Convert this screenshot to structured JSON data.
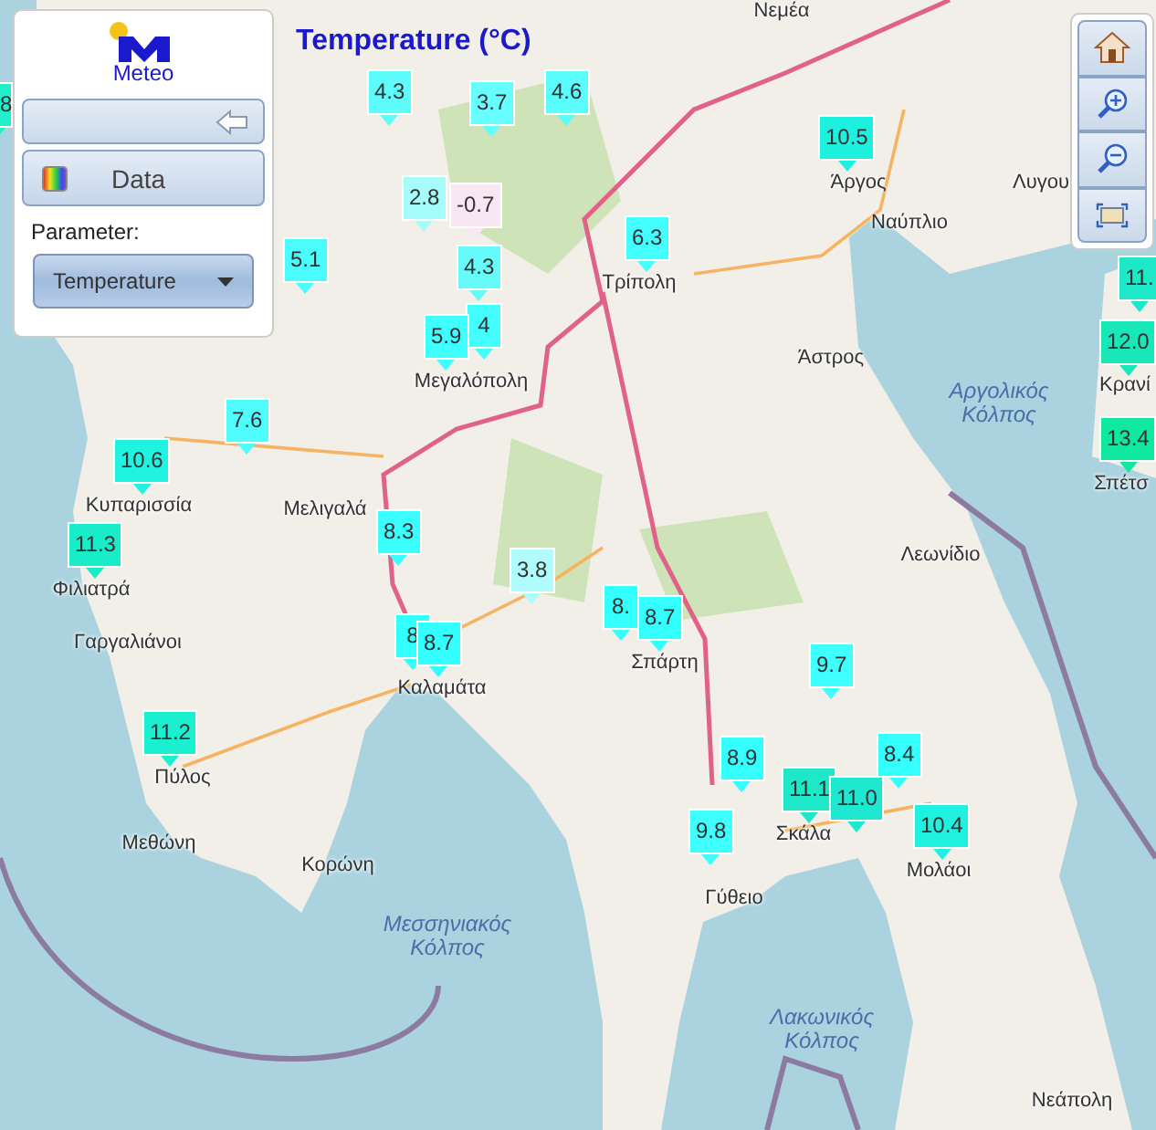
{
  "panel": {
    "logo_text": "Meteo",
    "data_button": "Data",
    "parameter_label": "Parameter:",
    "parameter_value": "Temperature"
  },
  "title": "Temperature (°C)",
  "markers": [
    {
      "value": "8",
      "color": "#22eecc"
    },
    {
      "value": "4.3",
      "color": "#5ffcfc"
    },
    {
      "value": "3.7",
      "color": "#66fefe"
    },
    {
      "value": "4.6",
      "color": "#5afcfc"
    },
    {
      "value": "2.8",
      "color": "#a6fbfb"
    },
    {
      "value": "-0.7",
      "color": "#f8e6f2"
    },
    {
      "value": "4.3",
      "color": "#66fafa"
    },
    {
      "value": "5.1",
      "color": "#4cfcfc"
    },
    {
      "value": "4",
      "color": "#44fefe"
    },
    {
      "value": "5.9",
      "color": "#40ffff"
    },
    {
      "value": "6.3",
      "color": "#44ffff"
    },
    {
      "value": "10.5",
      "color": "#1ef0e0"
    },
    {
      "value": "11.",
      "color": "#1ee8c8"
    },
    {
      "value": "12.0",
      "color": "#18e8b8"
    },
    {
      "value": "13.4",
      "color": "#10e8a0"
    },
    {
      "value": "7.6",
      "color": "#50fcfc"
    },
    {
      "value": "10.6",
      "color": "#20f4e0"
    },
    {
      "value": "11.3",
      "color": "#18ecc8"
    },
    {
      "value": "8.3",
      "color": "#3cfefe"
    },
    {
      "value": "3.8",
      "color": "#b0fbfb"
    },
    {
      "value": "8",
      "color": "#33ffff"
    },
    {
      "value": "8.7",
      "color": "#33ffff"
    },
    {
      "value": "11.2",
      "color": "#1af0d0"
    },
    {
      "value": "8.",
      "color": "#33ffff"
    },
    {
      "value": "8.7",
      "color": "#33ffff"
    },
    {
      "value": "9.7",
      "color": "#40ffff"
    },
    {
      "value": "8.9",
      "color": "#36ffff"
    },
    {
      "value": "8.4",
      "color": "#36ffff"
    },
    {
      "value": "11.1",
      "color": "#1ee8c8"
    },
    {
      "value": "11.0",
      "color": "#1ee8d0"
    },
    {
      "value": "9.8",
      "color": "#40ffff"
    },
    {
      "value": "10.4",
      "color": "#20f0e0"
    }
  ],
  "places": [
    {
      "name": "Νεμέα",
      "kind": "town"
    },
    {
      "name": "Άργος",
      "kind": "town"
    },
    {
      "name": "Ναύπλιο",
      "kind": "town"
    },
    {
      "name": "Λυγου",
      "kind": "town"
    },
    {
      "name": "Τρίπολη",
      "kind": "town"
    },
    {
      "name": "Άστρος",
      "kind": "town"
    },
    {
      "name": "Αργολικός Κόλπος",
      "kind": "sea"
    },
    {
      "name": "Κρανί",
      "kind": "town"
    },
    {
      "name": "Σπέτσ",
      "kind": "town"
    },
    {
      "name": "Μεγαλόπολη",
      "kind": "town"
    },
    {
      "name": "Κυπαρισσία",
      "kind": "town"
    },
    {
      "name": "Μελιγαλά",
      "kind": "town"
    },
    {
      "name": "Φιλιατρά",
      "kind": "town"
    },
    {
      "name": "Γαργαλιάνοι",
      "kind": "town"
    },
    {
      "name": "Καλαμάτα",
      "kind": "town"
    },
    {
      "name": "Σπάρτη",
      "kind": "town"
    },
    {
      "name": "Λεωνίδιο",
      "kind": "town"
    },
    {
      "name": "Πύλος",
      "kind": "town"
    },
    {
      "name": "Μεθώνη",
      "kind": "town"
    },
    {
      "name": "Κορώνη",
      "kind": "town"
    },
    {
      "name": "Σκάλα",
      "kind": "town"
    },
    {
      "name": "Γύθειο",
      "kind": "town"
    },
    {
      "name": "Μολάοι",
      "kind": "town"
    },
    {
      "name": "Μεσσηνιακός Κόλπος",
      "kind": "sea"
    },
    {
      "name": "Λακωνικός Κόλπος",
      "kind": "sea"
    },
    {
      "name": "Νεάπολη",
      "kind": "town"
    }
  ]
}
